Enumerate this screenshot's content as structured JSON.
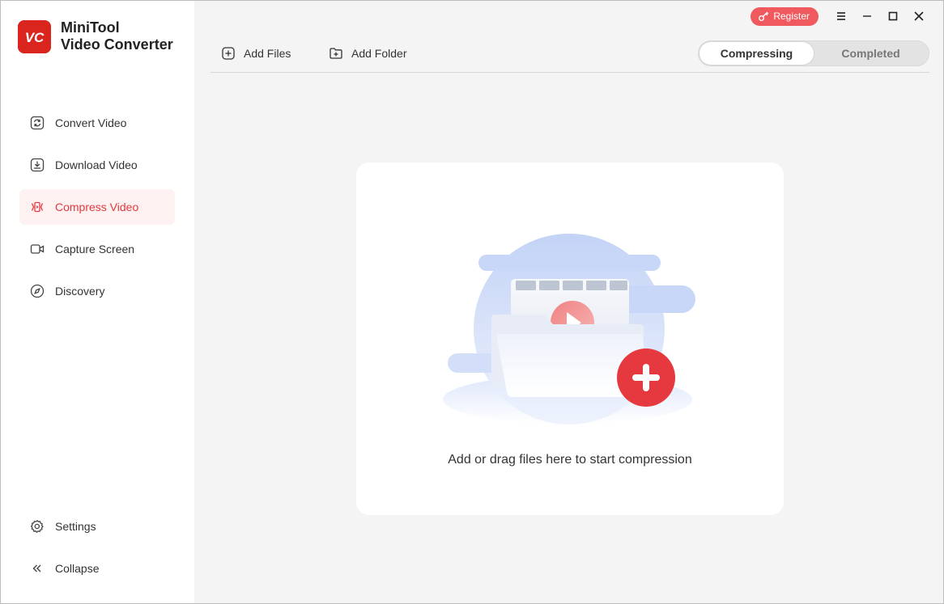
{
  "app": {
    "name_line1": "MiniTool",
    "name_line2": "Video Converter",
    "logo_text": "VC",
    "accent_color": "#e5393f"
  },
  "title_bar": {
    "register_label": "Register",
    "icons": [
      "key-icon",
      "menu-icon",
      "minimize-icon",
      "maximize-icon",
      "close-icon"
    ]
  },
  "sidebar": {
    "items": [
      {
        "label": "Convert Video",
        "icon": "convert-icon",
        "active": false
      },
      {
        "label": "Download Video",
        "icon": "download-icon",
        "active": false
      },
      {
        "label": "Compress Video",
        "icon": "compress-icon",
        "active": true
      },
      {
        "label": "Capture Screen",
        "icon": "camera-icon",
        "active": false
      },
      {
        "label": "Discovery",
        "icon": "compass-icon",
        "active": false
      }
    ],
    "bottom": [
      {
        "label": "Settings",
        "icon": "gear-icon"
      },
      {
        "label": "Collapse",
        "icon": "double-chevron-left-icon"
      }
    ]
  },
  "toolbar": {
    "add_files_label": "Add Files",
    "add_folder_label": "Add Folder",
    "tabs": [
      {
        "label": "Compressing",
        "active": true
      },
      {
        "label": "Completed",
        "active": false
      }
    ]
  },
  "dropzone": {
    "text": "Add or drag files here to start compression"
  }
}
